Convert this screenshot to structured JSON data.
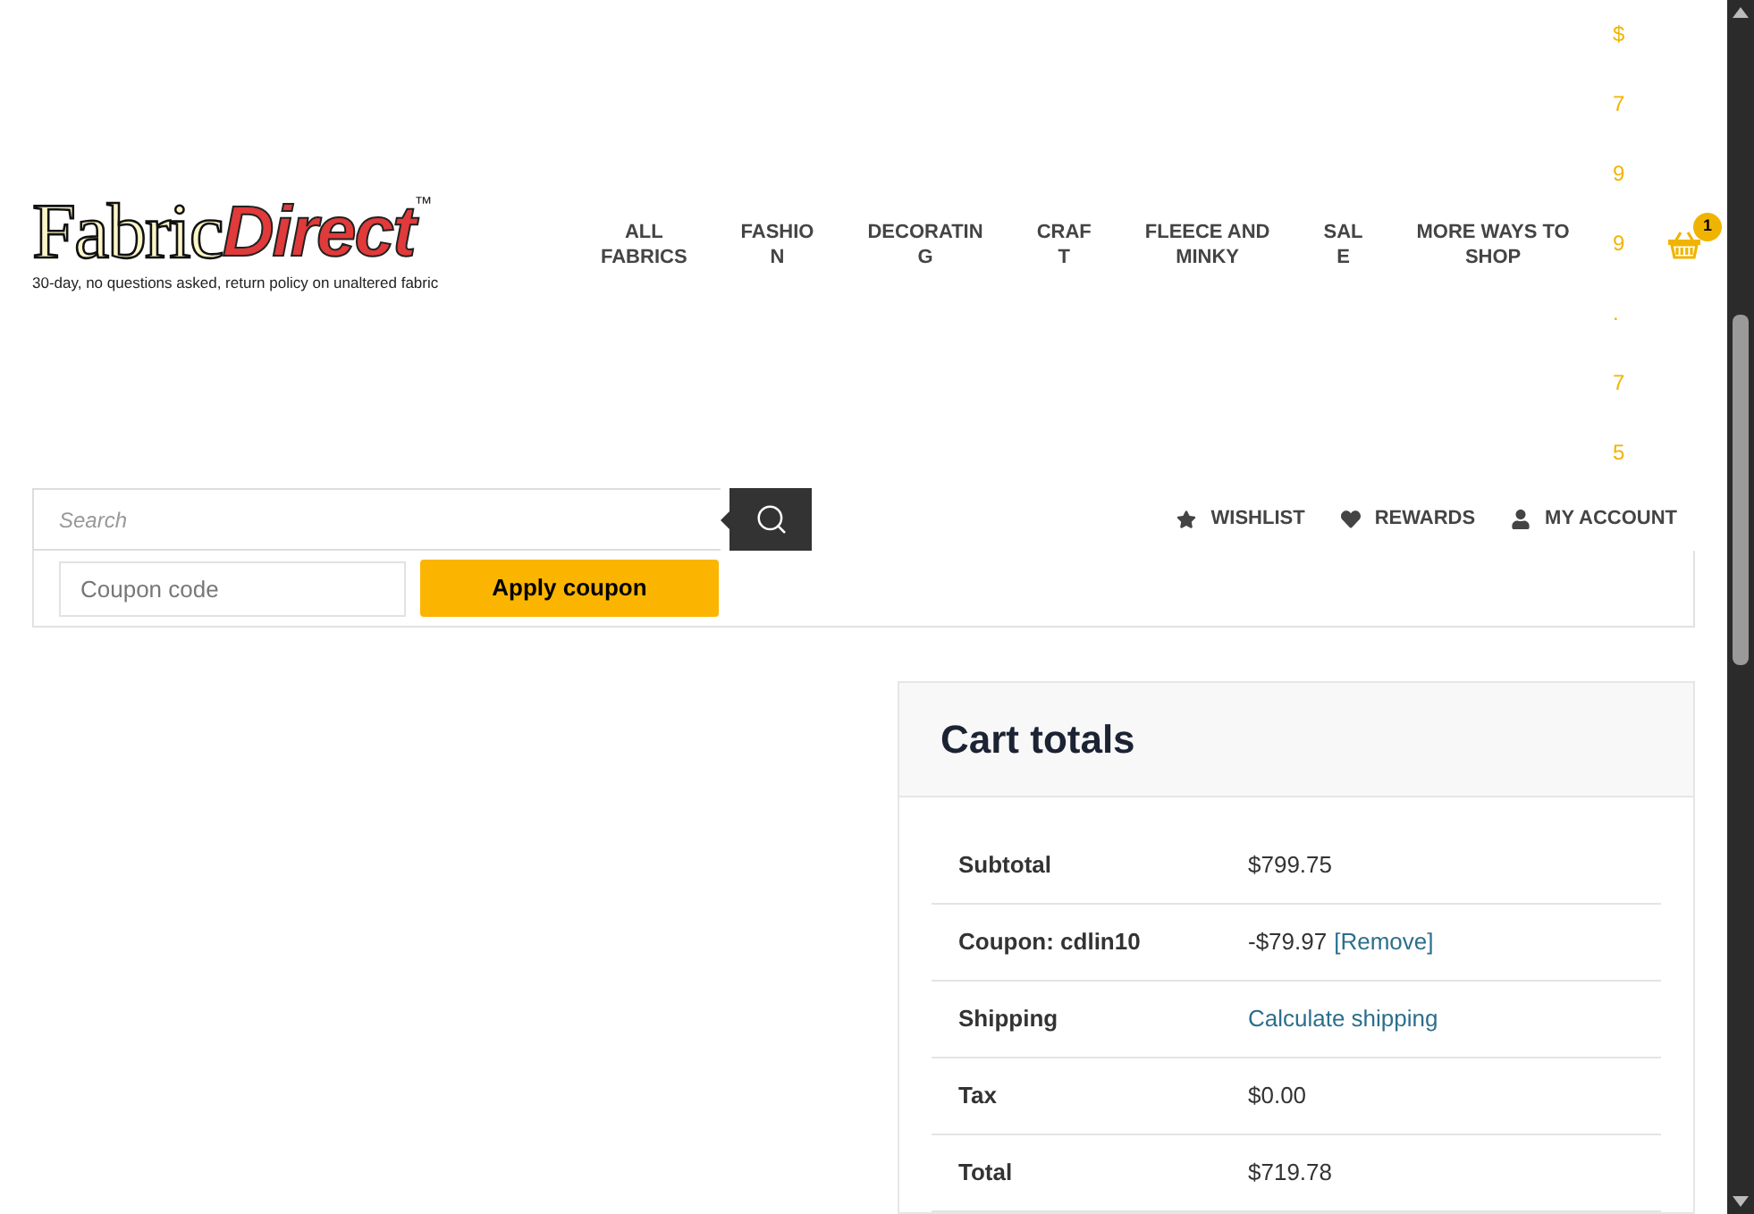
{
  "logo": {
    "word_1": "Fabric",
    "word_2": "Direct",
    "trademark": "™",
    "tagline": "30-day, no questions asked, return policy on unaltered fabric"
  },
  "nav": [
    {
      "lines": [
        "ALL",
        "FABRICS"
      ]
    },
    {
      "lines": [
        "FASHIO",
        "N"
      ]
    },
    {
      "lines": [
        "DECORATIN",
        "G"
      ]
    },
    {
      "lines": [
        "CRAF",
        "T"
      ]
    },
    {
      "lines": [
        "FLEECE AND",
        "MINKY"
      ]
    },
    {
      "lines": [
        "SAL",
        "E"
      ]
    },
    {
      "lines": [
        "MORE WAYS TO",
        "SHOP"
      ]
    }
  ],
  "cart": {
    "price": "$799.75",
    "badge": "1"
  },
  "search": {
    "placeholder": "Search"
  },
  "account_links": [
    {
      "kind": "wishlist",
      "label": "WISHLIST"
    },
    {
      "kind": "rewards",
      "label": "REWARDS"
    },
    {
      "kind": "account",
      "label": "MY ACCOUNT"
    }
  ],
  "coupon": {
    "placeholder": "Coupon code",
    "button": "Apply coupon"
  },
  "cart_totals": {
    "title": "Cart totals",
    "rows": [
      {
        "label": "Subtotal",
        "value": "$799.75"
      },
      {
        "label": "Coupon: cdlin10",
        "value": "-$79.97",
        "link": "[Remove]"
      },
      {
        "label": "Shipping",
        "link": "Calculate shipping"
      },
      {
        "label": "Tax",
        "value": "$0.00"
      },
      {
        "label": "Total",
        "value": "$719.78"
      }
    ]
  }
}
